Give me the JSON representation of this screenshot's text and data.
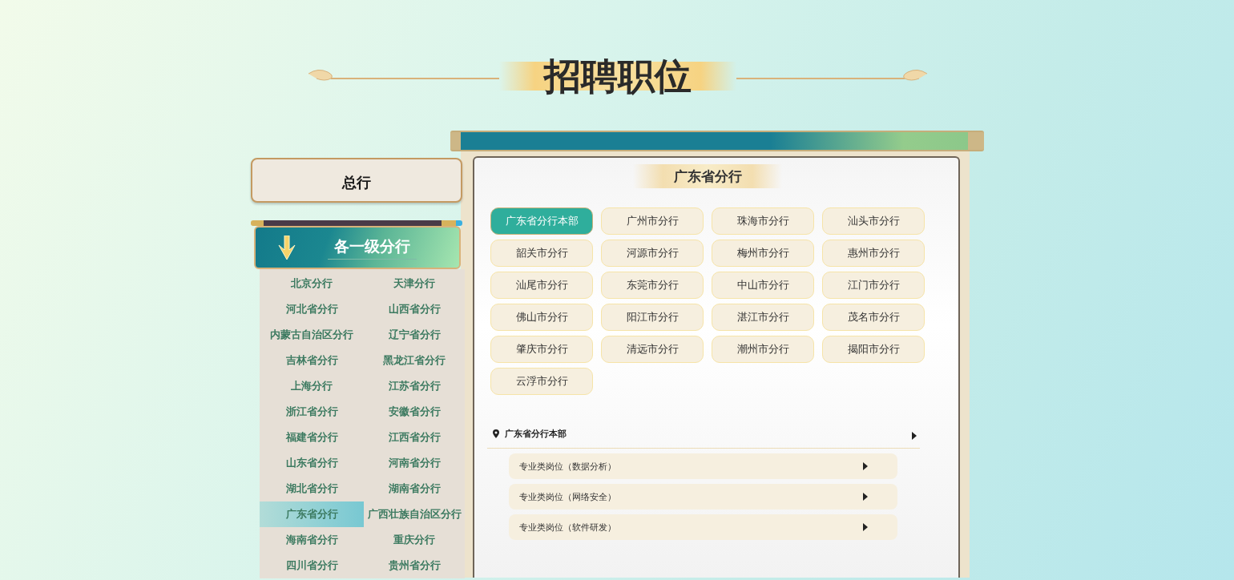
{
  "page_title": "招聘职位",
  "head_office": {
    "label": "总行"
  },
  "branches_header": {
    "title": "各一级分行"
  },
  "branches": [
    {
      "label": "北京分行",
      "selected": false
    },
    {
      "label": "天津分行",
      "selected": false
    },
    {
      "label": "河北省分行",
      "selected": false
    },
    {
      "label": "山西省分行",
      "selected": false
    },
    {
      "label": "内蒙古自治区分行",
      "selected": false
    },
    {
      "label": "辽宁省分行",
      "selected": false
    },
    {
      "label": "吉林省分行",
      "selected": false
    },
    {
      "label": "黑龙江省分行",
      "selected": false
    },
    {
      "label": "上海分行",
      "selected": false
    },
    {
      "label": "江苏省分行",
      "selected": false
    },
    {
      "label": "浙江省分行",
      "selected": false
    },
    {
      "label": "安徽省分行",
      "selected": false
    },
    {
      "label": "福建省分行",
      "selected": false
    },
    {
      "label": "江西省分行",
      "selected": false
    },
    {
      "label": "山东省分行",
      "selected": false
    },
    {
      "label": "河南省分行",
      "selected": false
    },
    {
      "label": "湖北省分行",
      "selected": false
    },
    {
      "label": "湖南省分行",
      "selected": false
    },
    {
      "label": "广东省分行",
      "selected": true
    },
    {
      "label": "广西壮族自治区分行",
      "selected": false
    },
    {
      "label": "海南省分行",
      "selected": false
    },
    {
      "label": "重庆分行",
      "selected": false
    },
    {
      "label": "四川省分行",
      "selected": false
    },
    {
      "label": "贵州省分行",
      "selected": false
    }
  ],
  "province_panel": {
    "title": "广东省分行",
    "sub_branches": [
      {
        "label": "广东省分行本部",
        "selected": true
      },
      {
        "label": "广州市分行",
        "selected": false
      },
      {
        "label": "珠海市分行",
        "selected": false
      },
      {
        "label": "汕头市分行",
        "selected": false
      },
      {
        "label": "韶关市分行",
        "selected": false
      },
      {
        "label": "河源市分行",
        "selected": false
      },
      {
        "label": "梅州市分行",
        "selected": false
      },
      {
        "label": "惠州市分行",
        "selected": false
      },
      {
        "label": "汕尾市分行",
        "selected": false
      },
      {
        "label": "东莞市分行",
        "selected": false
      },
      {
        "label": "中山市分行",
        "selected": false
      },
      {
        "label": "江门市分行",
        "selected": false
      },
      {
        "label": "佛山市分行",
        "selected": false
      },
      {
        "label": "阳江市分行",
        "selected": false
      },
      {
        "label": "湛江市分行",
        "selected": false
      },
      {
        "label": "茂名市分行",
        "selected": false
      },
      {
        "label": "肇庆市分行",
        "selected": false
      },
      {
        "label": "清远市分行",
        "selected": false
      },
      {
        "label": "潮州市分行",
        "selected": false
      },
      {
        "label": "揭阳市分行",
        "selected": false
      },
      {
        "label": "云浮市分行",
        "selected": false
      }
    ],
    "location": {
      "name": "广东省分行本部"
    },
    "positions": [
      {
        "label": "专业类岗位（数据分析）"
      },
      {
        "label": "专业类岗位（网络安全）"
      },
      {
        "label": "专业类岗位（软件研发）"
      }
    ]
  }
}
